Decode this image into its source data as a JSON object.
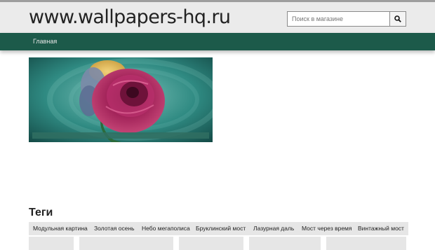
{
  "site": {
    "title": "www.wallpapers-hq.ru"
  },
  "search": {
    "placeholder": "Поиск в магазине"
  },
  "nav": {
    "items": [
      {
        "label": "Главная"
      }
    ]
  },
  "tags": {
    "title": "Теги",
    "items": [
      "Модульная картина",
      "Золотая осень",
      "Небо мегаполиса",
      "Бруклинский мост",
      "Лазурная даль",
      "Мост через время",
      "Винтажный мост"
    ]
  },
  "colors": {
    "nav_bg": "#1c5a4a",
    "header_bg": "#ebebeb",
    "tag_bg": "#e6e6e6"
  }
}
